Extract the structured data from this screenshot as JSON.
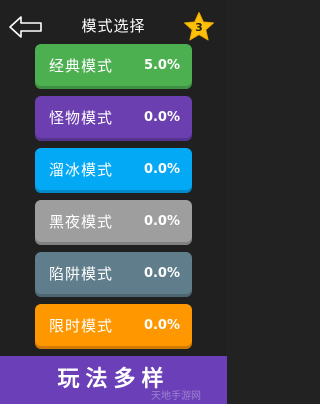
{
  "header": {
    "title": "模式选择",
    "back_icon": "arrow-left-icon",
    "star_icon": "star-icon",
    "star_count": "3"
  },
  "modes": [
    {
      "name": "经典模式",
      "percent": "5.0%",
      "color": "#4caf50"
    },
    {
      "name": "怪物模式",
      "percent": "0.0%",
      "color": "#6b3fb0"
    },
    {
      "name": "溜冰模式",
      "percent": "0.0%",
      "color": "#03a9f4"
    },
    {
      "name": "黑夜模式",
      "percent": "0.0%",
      "color": "#9e9e9e"
    },
    {
      "name": "陷阱模式",
      "percent": "0.0%",
      "color": "#607d8b"
    },
    {
      "name": "限时模式",
      "percent": "0.0%",
      "color": "#ff9800"
    }
  ],
  "banner": {
    "text": "玩法多样",
    "color": "#6a3fb8"
  },
  "watermark": "天地手游网"
}
